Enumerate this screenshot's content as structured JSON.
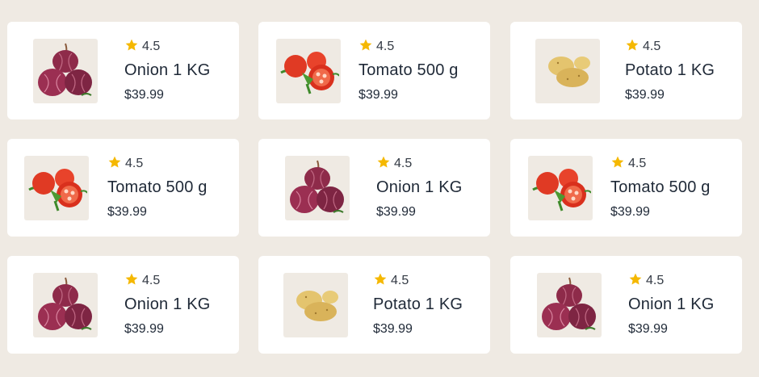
{
  "products": [
    {
      "name": "Onion 1 KG",
      "price": "$39.99",
      "rating": "4.5",
      "image": "onion-image"
    },
    {
      "name": "Tomato 500 g",
      "price": "$39.99",
      "rating": "4.5",
      "image": "tomato-image"
    },
    {
      "name": "Potato 1 KG",
      "price": "$39.99",
      "rating": "4.5",
      "image": "potato-image"
    },
    {
      "name": "Tomato 500 g",
      "price": "$39.99",
      "rating": "4.5",
      "image": "tomato-image"
    },
    {
      "name": "Onion 1 KG",
      "price": "$39.99",
      "rating": "4.5",
      "image": "onion-image"
    },
    {
      "name": "Tomato 500 g",
      "price": "$39.99",
      "rating": "4.5",
      "image": "tomato-image"
    },
    {
      "name": "Onion 1 KG",
      "price": "$39.99",
      "rating": "4.5",
      "image": "onion-image"
    },
    {
      "name": "Potato 1 KG",
      "price": "$39.99",
      "rating": "4.5",
      "image": "potato-image"
    },
    {
      "name": "Onion 1 KG",
      "price": "$39.99",
      "rating": "4.5",
      "image": "onion-image"
    }
  ],
  "colors": {
    "background": "#efeae3",
    "card": "#ffffff",
    "star": "#f5b800",
    "text": "#1f2937"
  }
}
